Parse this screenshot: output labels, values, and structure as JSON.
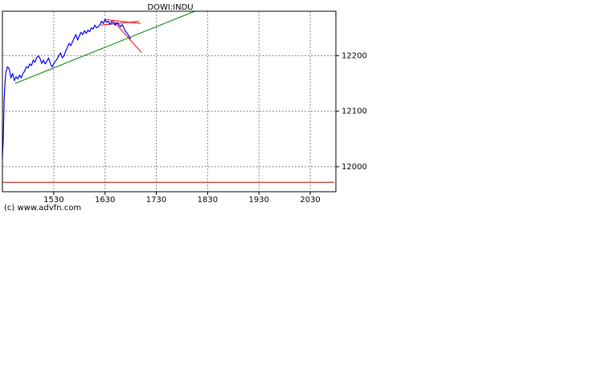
{
  "chart_data": {
    "type": "line",
    "title": "DOWI:INDU",
    "xlabel": "",
    "ylabel": "",
    "x_ticks": [
      "1530",
      "1630",
      "1730",
      "1830",
      "1930",
      "2030"
    ],
    "y_ticks": [
      12000,
      12100,
      12200
    ],
    "xlim": [
      "1430",
      "2100"
    ],
    "ylim": [
      11955,
      12280
    ],
    "grid": true,
    "y_axis_position": "right",
    "price_series": {
      "color": "#0000ff",
      "points": [
        [
          "1430",
          12015
        ],
        [
          "1431",
          12050
        ],
        [
          "1432",
          12120
        ],
        [
          "1433",
          12150
        ],
        [
          "1434",
          12170
        ],
        [
          "1436",
          12180
        ],
        [
          "1438",
          12176
        ],
        [
          "1440",
          12160
        ],
        [
          "1442",
          12168
        ],
        [
          "1444",
          12155
        ],
        [
          "1446",
          12162
        ],
        [
          "1448",
          12158
        ],
        [
          "1450",
          12165
        ],
        [
          "1452",
          12160
        ],
        [
          "1454",
          12168
        ],
        [
          "1456",
          12172
        ],
        [
          "1458",
          12180
        ],
        [
          "1500",
          12178
        ],
        [
          "1502",
          12185
        ],
        [
          "1504",
          12182
        ],
        [
          "1506",
          12192
        ],
        [
          "1508",
          12188
        ],
        [
          "1510",
          12196
        ],
        [
          "1512",
          12200
        ],
        [
          "1514",
          12195
        ],
        [
          "1516",
          12186
        ],
        [
          "1518",
          12192
        ],
        [
          "1520",
          12185
        ],
        [
          "1522",
          12190
        ],
        [
          "1524",
          12196
        ],
        [
          "1526",
          12186
        ],
        [
          "1528",
          12180
        ],
        [
          "1530",
          12185
        ],
        [
          "1532",
          12190
        ],
        [
          "1534",
          12194
        ],
        [
          "1536",
          12200
        ],
        [
          "1538",
          12205
        ],
        [
          "1540",
          12196
        ],
        [
          "1542",
          12200
        ],
        [
          "1544",
          12208
        ],
        [
          "1546",
          12215
        ],
        [
          "1548",
          12222
        ],
        [
          "1550",
          12218
        ],
        [
          "1552",
          12225
        ],
        [
          "1554",
          12232
        ],
        [
          "1556",
          12238
        ],
        [
          "1558",
          12228
        ],
        [
          "1600",
          12236
        ],
        [
          "1602",
          12242
        ],
        [
          "1604",
          12238
        ],
        [
          "1606",
          12245
        ],
        [
          "1608",
          12240
        ],
        [
          "1610",
          12246
        ],
        [
          "1612",
          12243
        ],
        [
          "1614",
          12250
        ],
        [
          "1616",
          12248
        ],
        [
          "1618",
          12255
        ],
        [
          "1620",
          12250
        ],
        [
          "1622",
          12252
        ],
        [
          "1624",
          12256
        ],
        [
          "1626",
          12262
        ],
        [
          "1628",
          12258
        ],
        [
          "1630",
          12265
        ],
        [
          "1632",
          12260
        ],
        [
          "1634",
          12262
        ],
        [
          "1636",
          12256
        ],
        [
          "1638",
          12262
        ],
        [
          "1640",
          12258
        ],
        [
          "1642",
          12255
        ],
        [
          "1644",
          12260
        ],
        [
          "1646",
          12256
        ],
        [
          "1648",
          12252
        ],
        [
          "1650",
          12256
        ],
        [
          "1652",
          12250
        ],
        [
          "1654",
          12244
        ],
        [
          "1656",
          12240
        ],
        [
          "1658",
          12235
        ],
        [
          "1700",
          12230
        ]
      ]
    },
    "trend_lines": [
      {
        "color": "#008000",
        "from": [
          "1445",
          12150
        ],
        "to": [
          "1815",
          12280
        ]
      },
      {
        "color": "#ff0000",
        "from": [
          "1640",
          12262
        ],
        "to": [
          "1713",
          12205
        ]
      },
      {
        "color": "#ff0000",
        "from": [
          "1630",
          12265
        ],
        "to": [
          "1712",
          12258
        ]
      },
      {
        "color": "#ff0000",
        "from": [
          "1625",
          12255
        ],
        "to": [
          "1710",
          12262
        ]
      }
    ],
    "level_lines": [
      {
        "color": "#cc0000",
        "y": 11972
      }
    ]
  },
  "footer": {
    "copyright": "(c) www.advfn.com"
  }
}
